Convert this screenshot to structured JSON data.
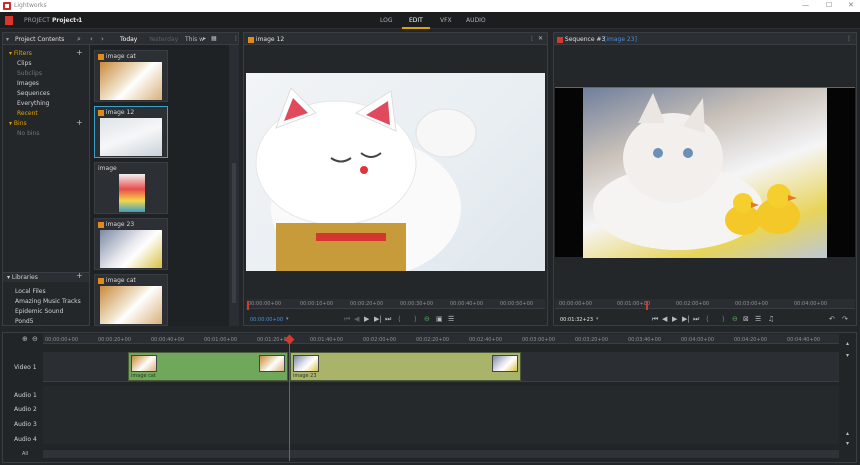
{
  "app": {
    "title": "Lightworks"
  },
  "menubar": {
    "project_label": "PROJECT",
    "project_name": "Project 1",
    "tabs": [
      "LOG",
      "EDIT",
      "VFX",
      "AUDIO"
    ]
  },
  "content_panel": {
    "title": "Project Contents",
    "date_nav": {
      "today": "Today",
      "yesterday": "Yesterday",
      "this_week": "This w"
    },
    "filters": {
      "heading": "Filters",
      "items": [
        "Clips",
        "Subclips",
        "Images",
        "Sequences",
        "Everything",
        "Recent"
      ]
    },
    "bins": {
      "heading": "Bins",
      "empty": "No bins"
    },
    "libraries": {
      "heading": "Libraries",
      "items": [
        "Local Files",
        "Amazing Music Tracks",
        "Epidemic Sound",
        "Pond5"
      ]
    },
    "thumbnails": [
      {
        "title": "image cat"
      },
      {
        "title": "image 12"
      },
      {
        "title": "image"
      },
      {
        "title": "image 23"
      },
      {
        "title": "image cat"
      }
    ]
  },
  "source_viewer": {
    "title": "image 12",
    "ruler": [
      "00:00:00+00",
      "00:00:10+00",
      "00:00:20+00",
      "00:00:30+00",
      "00:00:40+00",
      "00:00:50+00"
    ],
    "timecode": "00:00:00+00"
  },
  "record_viewer": {
    "title": "Sequence #3",
    "subtitle": "[image 23]",
    "ruler": [
      "00:00:00+00",
      "00:01:00+00",
      "00:02:00+00",
      "00:03:00+00",
      "00:04:00+00"
    ],
    "timecode": "00:01:32+23"
  },
  "timeline": {
    "ruler": [
      "00:00:00+00",
      "00:00:20+00",
      "00:00:40+00",
      "00:01:00+00",
      "00:01:20+00",
      "00:01:40+00",
      "00:02:00+00",
      "00:02:20+00",
      "00:02:40+00",
      "00:03:00+00",
      "00:03:20+00",
      "00:03:40+00",
      "00:04:00+00",
      "00:04:20+00",
      "00:04:40+00"
    ],
    "tracks": [
      "Video 1",
      "Audio 1",
      "Audio 2",
      "Audio 3",
      "Audio 4"
    ],
    "all_label": "All",
    "clips": [
      {
        "name": "image cat"
      },
      {
        "name": "image 23"
      }
    ]
  },
  "colors": {
    "accent": "#e0a000",
    "selection": "#3aa0c8",
    "playhead": "#d13b2e",
    "clip_green": "#6fa85a",
    "clip_olive": "#a9b36a"
  }
}
